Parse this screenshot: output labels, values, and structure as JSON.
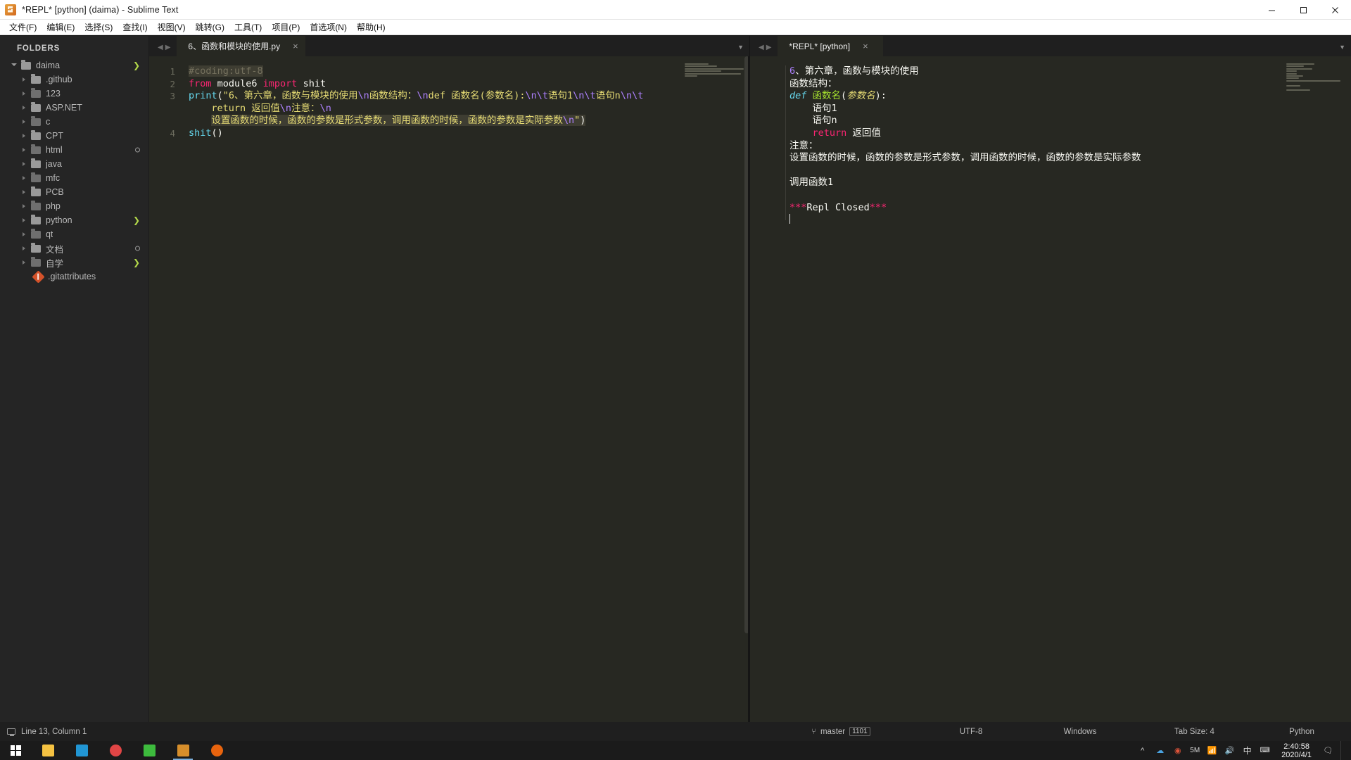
{
  "window": {
    "title": "*REPL* [python] (daima) - Sublime Text",
    "app_icon": "sublime-text-icon",
    "controls": {
      "minimize": "minimize-icon",
      "maximize": "maximize-icon",
      "close": "close-icon"
    }
  },
  "menubar": {
    "items": [
      {
        "label": "文件(F)"
      },
      {
        "label": "编辑(E)"
      },
      {
        "label": "选择(S)"
      },
      {
        "label": "查找(I)"
      },
      {
        "label": "视图(V)"
      },
      {
        "label": "跳转(G)"
      },
      {
        "label": "工具(T)"
      },
      {
        "label": "项目(P)"
      },
      {
        "label": "首选项(N)"
      },
      {
        "label": "帮助(H)"
      }
    ]
  },
  "sidebar": {
    "title": "FOLDERS",
    "root": {
      "label": "daima",
      "expanded": true,
      "badge": "chevron"
    },
    "items": [
      {
        "label": ".github",
        "badge": ""
      },
      {
        "label": "123",
        "badge": ""
      },
      {
        "label": "ASP.NET",
        "badge": ""
      },
      {
        "label": "c",
        "badge": ""
      },
      {
        "label": "CPT",
        "badge": ""
      },
      {
        "label": "html",
        "badge": "circle"
      },
      {
        "label": "java",
        "badge": ""
      },
      {
        "label": "mfc",
        "badge": ""
      },
      {
        "label": "PCB",
        "badge": ""
      },
      {
        "label": "php",
        "badge": ""
      },
      {
        "label": "python",
        "badge": "chevron"
      },
      {
        "label": "qt",
        "badge": ""
      },
      {
        "label": "文档",
        "badge": "circle"
      },
      {
        "label": "自学",
        "badge": "chevron"
      }
    ],
    "file": {
      "label": ".gitattributes",
      "icon": "git-file-icon"
    }
  },
  "left_pane": {
    "tab": {
      "title": "6、函数和模块的使用.py",
      "close": "×"
    },
    "nav": {
      "prev": "◀",
      "next": "▶",
      "menu": "▼"
    },
    "gutter": [
      "1",
      "2",
      "3",
      "",
      "",
      "4"
    ],
    "code_lines": [
      {
        "n": "1",
        "highlight": true,
        "tokens": [
          {
            "t": "#coding:utf-8",
            "c": "c-comment"
          }
        ]
      },
      {
        "n": "2",
        "tokens": [
          {
            "t": "from",
            "c": "c-kw"
          },
          {
            "t": " module6 ",
            "c": "c-plain"
          },
          {
            "t": "import",
            "c": "c-kw"
          },
          {
            "t": " shit",
            "c": "c-plain"
          }
        ]
      },
      {
        "n": "3",
        "tokens": [
          {
            "t": "print",
            "c": "c-fn"
          },
          {
            "t": "(",
            "c": "c-punc"
          },
          {
            "t": "\"6、第六章，函数与模块的使用",
            "c": "c-str"
          },
          {
            "t": "\\n",
            "c": "c-esc"
          },
          {
            "t": "函数结构：",
            "c": "c-str"
          },
          {
            "t": "\\n",
            "c": "c-esc"
          },
          {
            "t": "def 函数名(参数名):",
            "c": "c-str"
          },
          {
            "t": "\\n",
            "c": "c-esc"
          },
          {
            "t": "\\t",
            "c": "c-esc"
          },
          {
            "t": "语句1",
            "c": "c-str"
          },
          {
            "t": "\\n",
            "c": "c-esc"
          },
          {
            "t": "\\t",
            "c": "c-esc"
          },
          {
            "t": "语句n",
            "c": "c-str"
          },
          {
            "t": "\\n",
            "c": "c-esc"
          },
          {
            "t": "\\t",
            "c": "c-esc"
          }
        ]
      },
      {
        "n": "",
        "indent": 4,
        "tokens": [
          {
            "t": "return 返回值",
            "c": "c-str"
          },
          {
            "t": "\\n",
            "c": "c-esc"
          },
          {
            "t": "注意：",
            "c": "c-str"
          },
          {
            "t": "\\n",
            "c": "c-esc"
          }
        ]
      },
      {
        "n": "",
        "indent": 4,
        "highlight": true,
        "tokens": [
          {
            "t": "设置函数的时候，函数的参数是形式参数，调用函数的时候，函数的参数是实际参数",
            "c": "c-str"
          },
          {
            "t": "\\n",
            "c": "c-esc"
          },
          {
            "t": "\"",
            "c": "c-str"
          },
          {
            "t": ")",
            "c": "c-punc"
          }
        ]
      },
      {
        "n": "4",
        "tokens": [
          {
            "t": "shit",
            "c": "c-fn"
          },
          {
            "t": "()",
            "c": "c-punc"
          }
        ]
      }
    ]
  },
  "right_pane": {
    "tab": {
      "title": "*REPL* [python]",
      "close": "×"
    },
    "nav": {
      "prev": "◀",
      "next": "▶",
      "menu": "▼"
    },
    "output_lines": [
      [
        {
          "t": "6",
          "c": "c-esc"
        },
        {
          "t": "、第六章，函数与模块的使用",
          "c": "c-plain"
        }
      ],
      [
        {
          "t": "函数结构：",
          "c": "c-plain"
        }
      ],
      [
        {
          "t": "def",
          "c": "c-fn c-italic"
        },
        {
          "t": " ",
          "c": "c-plain"
        },
        {
          "t": "函数名",
          "c": "c-name"
        },
        {
          "t": "(",
          "c": "c-punc"
        },
        {
          "t": "参数名",
          "c": "c-str c-italic"
        },
        {
          "t": "):",
          "c": "c-punc"
        }
      ],
      [
        {
          "t": "    语句1",
          "c": "c-plain"
        }
      ],
      [
        {
          "t": "    语句n",
          "c": "c-plain"
        }
      ],
      [
        {
          "t": "    ",
          "c": "c-plain"
        },
        {
          "t": "return",
          "c": "c-kw"
        },
        {
          "t": " 返回值",
          "c": "c-plain"
        }
      ],
      [
        {
          "t": "注意：",
          "c": "c-plain"
        }
      ],
      [
        {
          "t": "设置函数的时候，函数的参数是形式参数，调用函数的时候，函数的参数是实际参数",
          "c": "c-plain"
        }
      ],
      [
        {
          "t": "",
          "c": "c-plain"
        }
      ],
      [
        {
          "t": "调用函数1",
          "c": "c-plain"
        }
      ],
      [
        {
          "t": "",
          "c": "c-plain"
        }
      ],
      [
        {
          "t": "***",
          "c": "c-kw"
        },
        {
          "t": "Repl Closed",
          "c": "c-plain"
        },
        {
          "t": "***",
          "c": "c-kw"
        }
      ]
    ]
  },
  "statusbar": {
    "cursor": "Line 13, Column 1",
    "branch_icon": "git-branch-icon",
    "branch": "master",
    "branch_count": "1101",
    "encoding": "UTF-8",
    "line_endings": "Windows",
    "tab_size": "Tab Size: 4",
    "syntax": "Python"
  },
  "taskbar": {
    "start": "windows-start-icon",
    "apps": [
      {
        "name": "file-explorer-icon",
        "color": "#f5c242"
      },
      {
        "name": "browser-icon",
        "color": "#2196d4"
      },
      {
        "name": "media-player-icon",
        "color": "#e04545"
      },
      {
        "name": "wechat-icon",
        "color": "#3dbb3d"
      },
      {
        "name": "sublime-text-icon",
        "color": "#d68e2b",
        "active": true
      },
      {
        "name": "firefox-icon",
        "color": "#e8640e"
      }
    ],
    "tray": {
      "chevron": "^",
      "icons": [
        "cloud-icon",
        "shield-icon",
        "network-icon",
        "speaker-icon"
      ],
      "net_label": "5M",
      "ime": "中",
      "ime2": "🔤"
    },
    "clock": {
      "time": "2:40:58",
      "date": "2020/4/1"
    },
    "notification": "notification-icon"
  },
  "colors": {
    "editor_bg": "#272822",
    "sidebar_bg": "#252525",
    "accent_green": "#a6e22e",
    "accent_pink": "#f92672",
    "accent_blue": "#66d9ef",
    "accent_yellow": "#e6db74",
    "accent_purple": "#ae81ff"
  }
}
